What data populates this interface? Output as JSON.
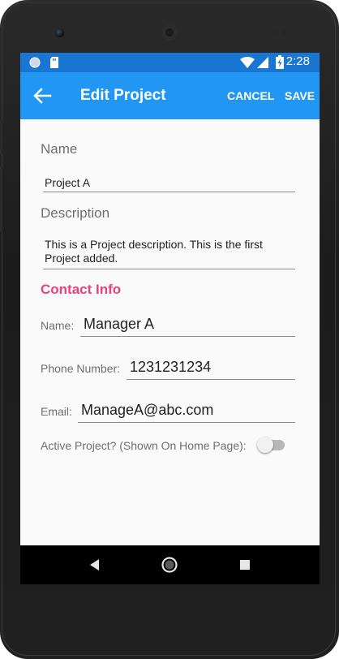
{
  "status_bar": {
    "time": "2:28",
    "icons": [
      "notification-dot-icon",
      "sd-card-icon",
      "wifi-icon",
      "signal-icon",
      "battery-charging-icon"
    ]
  },
  "app_bar": {
    "title": "Edit Project",
    "cancel_label": "CANCEL",
    "save_label": "SAVE"
  },
  "form": {
    "name_label": "Name",
    "name_value": "Project A",
    "description_label": "Description",
    "description_value_line1": "This is a Project description. This is the first",
    "description_value_line2": "Project added."
  },
  "contact": {
    "section_title": "Contact Info",
    "name_label": "Name:",
    "name_value": "Manager A",
    "phone_label": "Phone Number:",
    "phone_value": "1231231234",
    "email_label": "Email:",
    "email_value": "ManageA@abc.com"
  },
  "active": {
    "label": "Active Project? (Shown On Home Page):",
    "enabled": false
  },
  "colors": {
    "status_bar": "#1976d2",
    "app_bar": "#2196f3",
    "accent_pink": "#ec407a"
  },
  "nav_bar": [
    "back-triangle-icon",
    "home-circle-icon",
    "recents-square-icon"
  ]
}
